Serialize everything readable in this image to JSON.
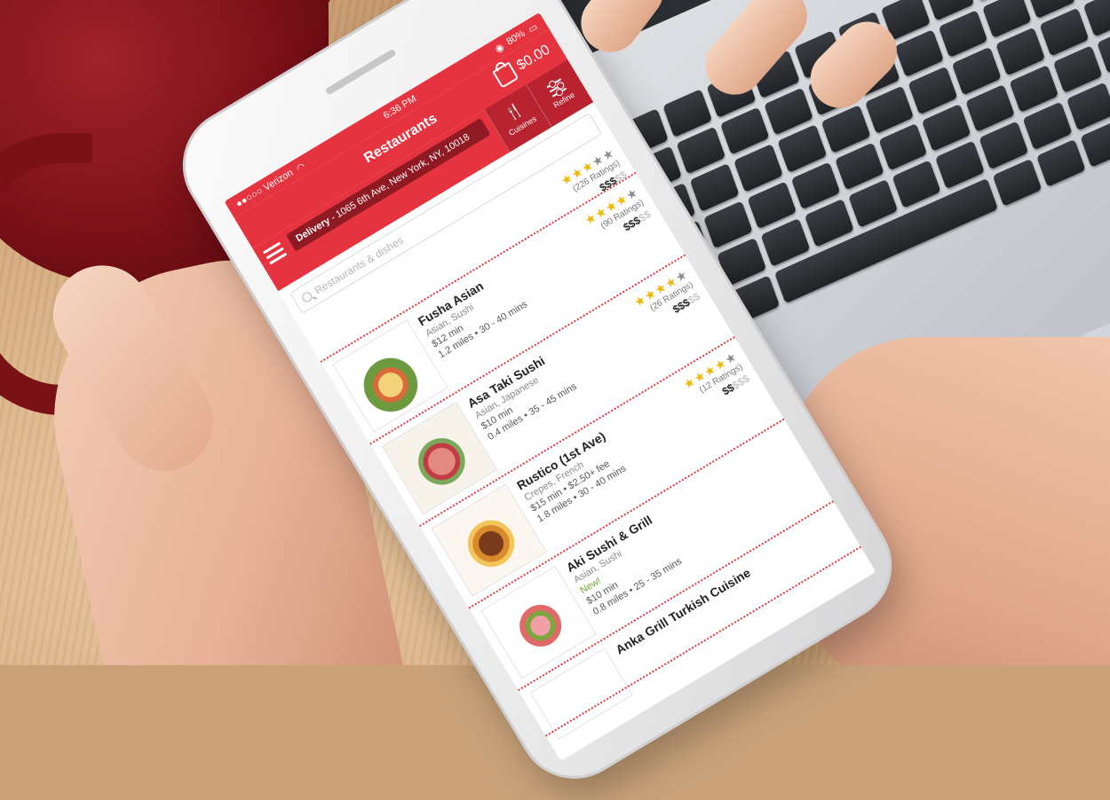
{
  "status_bar": {
    "carrier": "●●○○○ Verizon",
    "time": "6:36 PM",
    "battery": "80%"
  },
  "nav": {
    "title": "Restaurants",
    "cart_total": "$0.00",
    "menu_icon": "hamburger-icon",
    "cart_icon": "shopping-bag-icon"
  },
  "delivery": {
    "label": "Delivery",
    "address": " - 1065 6th Ave, New York, NY, 10018"
  },
  "filters": {
    "cuisines_label": "Cuisines",
    "refine_label": "Refine"
  },
  "search": {
    "placeholder": "Restaurants & dishes"
  },
  "colors": {
    "brand_red": "#e5333f",
    "dark_red": "#8f1a24",
    "star_yellow": "#f2b705",
    "new_green": "#6aa82e"
  },
  "restaurants": [
    {
      "name": "",
      "cuisine": "",
      "fee": "",
      "distance": "",
      "stars": 3,
      "ratings": "(226 Ratings)",
      "price_on": "$$$",
      "price_off": "$$"
    },
    {
      "name": "Fusha Asian",
      "cuisine": "Asian, Sushi",
      "fee": "$12 min",
      "distance": "1.2 miles • 30 - 40 mins",
      "stars": 4,
      "ratings": "(90 Ratings)",
      "price_on": "$$$",
      "price_off": "$$"
    },
    {
      "name": "Asa Taki Sushi",
      "cuisine": "Asian, Japanese",
      "fee": "$10 min",
      "distance": "0.4 miles • 35 - 45 mins",
      "stars": 4,
      "ratings": "(26 Ratings)",
      "price_on": "$$$",
      "price_off": "$$"
    },
    {
      "name": "Rustico (1st Ave)",
      "cuisine": "Crepes, French",
      "fee": "$15 min • $2.50+ fee",
      "distance": "1.8 miles • 30 - 40 mins",
      "stars": 4,
      "ratings": "(12 Ratings)",
      "price_on": "$$",
      "price_off": "$$$"
    },
    {
      "name": "Aki Sushi & Grill",
      "cuisine": "Asian, Sushi",
      "new_label": "New!",
      "fee": "$10 min",
      "distance": "0.8 miles • 25 - 35 mins"
    },
    {
      "name": "Anka Grill Turkish Cuisine"
    }
  ]
}
